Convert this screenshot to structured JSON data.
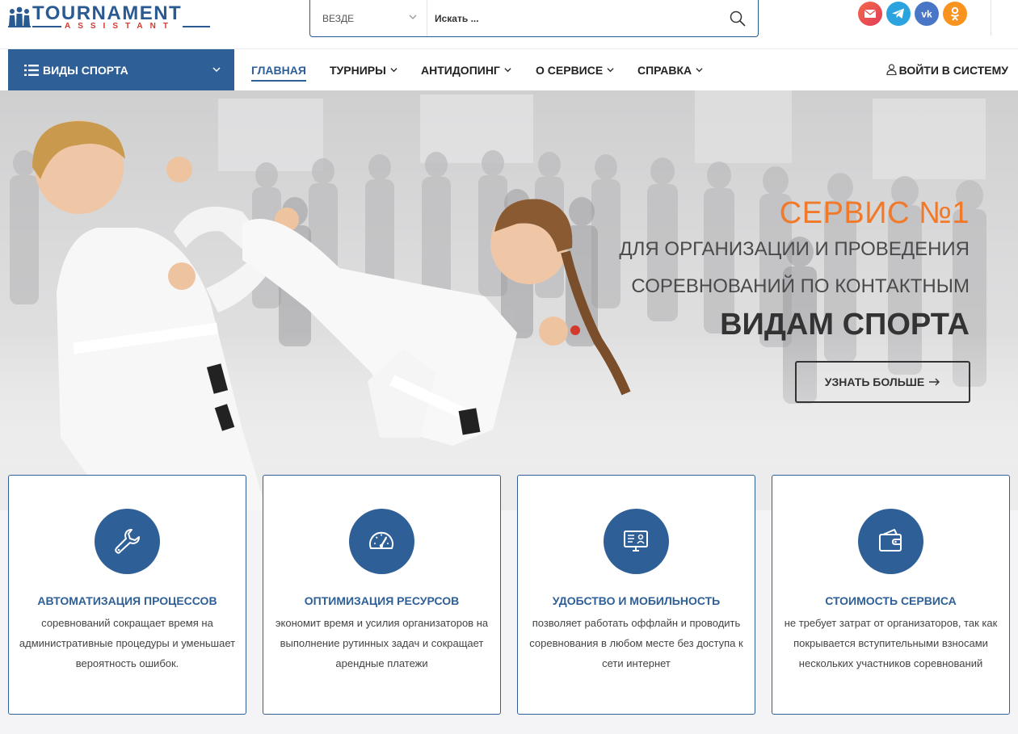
{
  "logo": {
    "title": "TOURNAMENT",
    "subtitle": "ASSISTANT"
  },
  "search": {
    "scope": "ВЕЗДЕ",
    "placeholder": "Искать ..."
  },
  "socials": [
    {
      "name": "email",
      "color": "#ef4f3f"
    },
    {
      "name": "telegram",
      "color": "#2aa3de"
    },
    {
      "name": "vk",
      "color": "#4a76a8"
    },
    {
      "name": "odnoklassniki",
      "color": "#f7931e"
    }
  ],
  "nav": {
    "sports_label": "ВИДЫ СПОРТА",
    "items": [
      {
        "label": "ГЛАВНАЯ",
        "active": true
      },
      {
        "label": "ТУРНИРЫ"
      },
      {
        "label": "АНТИДОПИНГ"
      },
      {
        "label": "О СЕРВИСЕ"
      },
      {
        "label": "СПРАВКА"
      }
    ],
    "login_label": "ВОЙТИ В СИСТЕМУ"
  },
  "hero": {
    "title": "СЕРВИС №1",
    "line1": "ДЛЯ ОРГАНИЗАЦИИ И ПРОВЕДЕНИЯ",
    "line2": "СОРЕВНОВАНИЙ ПО КОНТАКТНЫМ",
    "strong": "ВИДАМ СПОРТА",
    "button": "УЗНАТЬ БОЛЬШЕ"
  },
  "features": [
    {
      "icon": "wrench-icon",
      "title": "АВТОМАТИЗАЦИЯ ПРОЦЕССОВ",
      "text": "соревнований сокращает время на административные процедуры и уменьшает вероятность ошибок."
    },
    {
      "icon": "gauge-icon",
      "title": "ОПТИМИЗАЦИЯ РЕСУРСОВ",
      "text": "экономит время и усилия организаторов на выполнение рутинных задач и сокращает арендные платежи"
    },
    {
      "icon": "monitor-icon",
      "title": "УДОБСТВО И МОБИЛЬНОСТЬ",
      "text": "позволяет работать оффлайн и проводить соревнования в любом месте без доступа к сети интернет"
    },
    {
      "icon": "wallet-icon",
      "title": "СТОИМОСТЬ СЕРВИСА",
      "text": "не требует затрат от организаторов, так как покрывается вступительными взносами нескольких участников соревнований"
    }
  ],
  "colors": {
    "brand_blue": "#2e5f96",
    "accent_orange": "#f07a2a",
    "logo_red": "#d43a2f"
  }
}
